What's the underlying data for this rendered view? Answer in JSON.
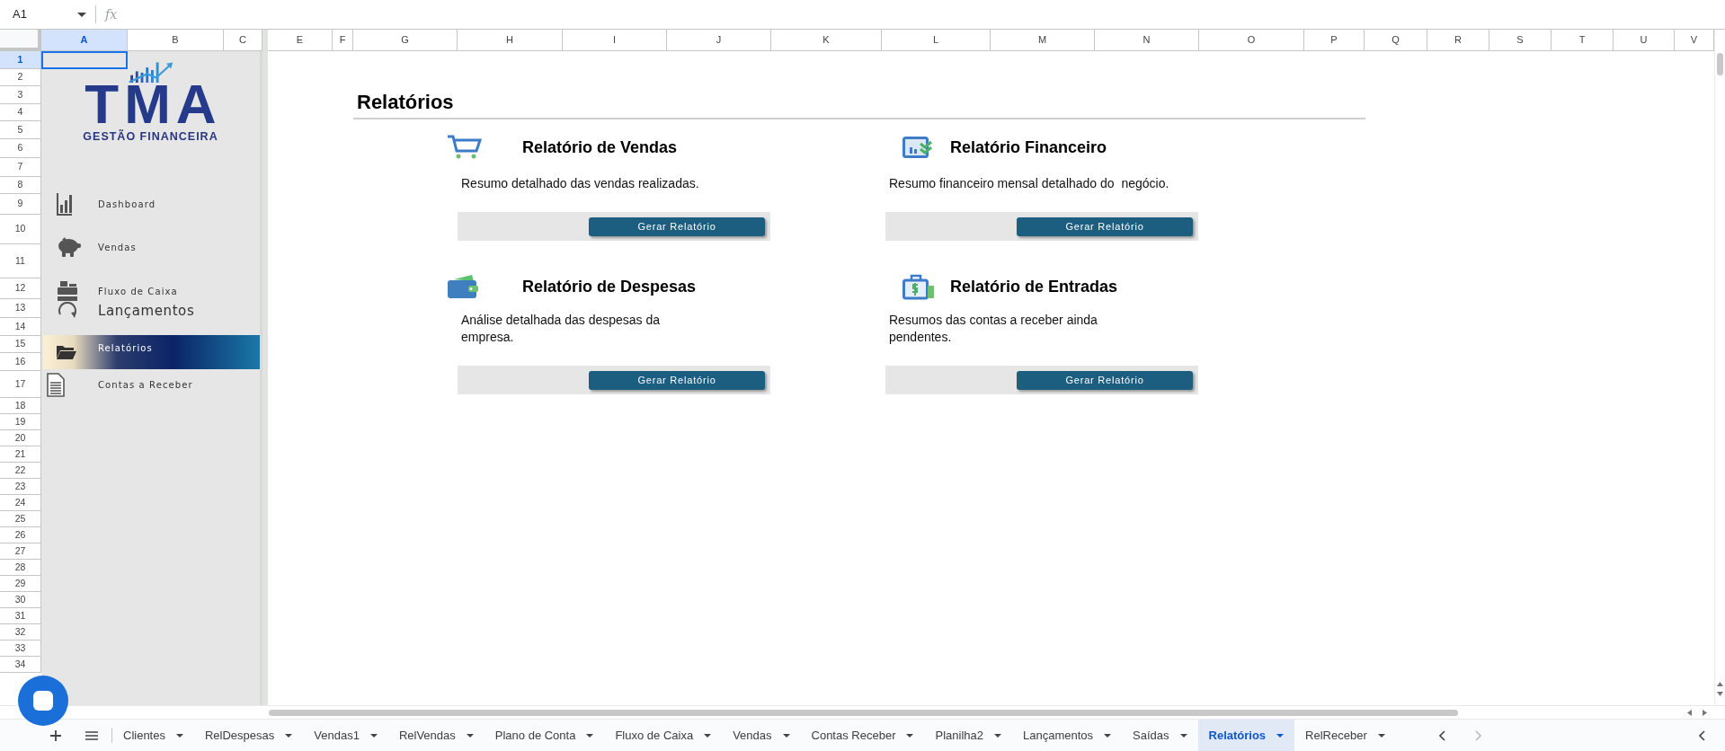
{
  "name_box": {
    "value": "A1"
  },
  "formula_bar": {
    "label": "fx"
  },
  "columns": [
    {
      "label": "A",
      "selected": true
    },
    {
      "label": "B",
      "selected": false
    },
    {
      "label": "C",
      "selected": false
    },
    {
      "label": "E",
      "selected": false
    },
    {
      "label": "F",
      "selected": false
    },
    {
      "label": "G",
      "selected": false
    },
    {
      "label": "H",
      "selected": false
    },
    {
      "label": "I",
      "selected": false
    },
    {
      "label": "J",
      "selected": false
    },
    {
      "label": "K",
      "selected": false
    },
    {
      "label": "L",
      "selected": false
    },
    {
      "label": "M",
      "selected": false
    },
    {
      "label": "N",
      "selected": false
    },
    {
      "label": "O",
      "selected": false
    },
    {
      "label": "P",
      "selected": false
    },
    {
      "label": "Q",
      "selected": false
    },
    {
      "label": "R",
      "selected": false
    },
    {
      "label": "S",
      "selected": false
    },
    {
      "label": "T",
      "selected": false
    },
    {
      "label": "U",
      "selected": false
    },
    {
      "label": "V",
      "selected": false
    }
  ],
  "rows": [
    {
      "label": "1",
      "selected": true
    },
    {
      "label": "2",
      "selected": false
    },
    {
      "label": "3",
      "selected": false
    },
    {
      "label": "4",
      "selected": false
    },
    {
      "label": "5",
      "selected": false
    },
    {
      "label": "6",
      "selected": false
    },
    {
      "label": "7",
      "selected": false
    },
    {
      "label": "8",
      "selected": false
    },
    {
      "label": "9",
      "selected": false
    },
    {
      "label": "10",
      "selected": false
    },
    {
      "label": "11",
      "selected": false
    },
    {
      "label": "12",
      "selected": false
    },
    {
      "label": "13",
      "selected": false
    },
    {
      "label": "14",
      "selected": false
    },
    {
      "label": "15",
      "selected": false
    },
    {
      "label": "16",
      "selected": false
    },
    {
      "label": "17",
      "selected": false
    },
    {
      "label": "18",
      "selected": false
    },
    {
      "label": "19",
      "selected": false
    },
    {
      "label": "20",
      "selected": false
    },
    {
      "label": "21",
      "selected": false
    },
    {
      "label": "22",
      "selected": false
    },
    {
      "label": "23",
      "selected": false
    },
    {
      "label": "24",
      "selected": false
    },
    {
      "label": "25",
      "selected": false
    },
    {
      "label": "26",
      "selected": false
    },
    {
      "label": "27",
      "selected": false
    },
    {
      "label": "28",
      "selected": false
    },
    {
      "label": "29",
      "selected": false
    },
    {
      "label": "30",
      "selected": false
    },
    {
      "label": "31",
      "selected": false
    },
    {
      "label": "32",
      "selected": false
    },
    {
      "label": "33",
      "selected": false
    },
    {
      "label": "34",
      "selected": false
    }
  ],
  "sidebar": {
    "logo": {
      "title": "TMA",
      "subtitle": "GESTÃO FINANCEIRA"
    },
    "items": [
      {
        "label": "Dashboard",
        "selected": false
      },
      {
        "label": "Vendas",
        "selected": false
      },
      {
        "label": "Fluxo de Caixa",
        "selected": false
      },
      {
        "label": "Lançamentos",
        "selected": false
      },
      {
        "label": "Relatórios",
        "selected": true
      },
      {
        "label": "Contas a Receber",
        "selected": false
      }
    ]
  },
  "page": {
    "title": "Relatórios",
    "reports": [
      {
        "title": "Relatório de Vendas",
        "description": "Resumo detalhado das vendas realizadas.",
        "button": "Gerar Relatório"
      },
      {
        "title": "Relatório Financeiro",
        "description": "Resumo financeiro mensal detalhado do  negócio.",
        "button": "Gerar Relatório"
      },
      {
        "title": "Relatório de Despesas",
        "description": "Análise detalhada das despesas da empresa.",
        "button": "Gerar Relatório"
      },
      {
        "title": "Relatório de Entradas",
        "description": "Resumos das contas a receber ainda pendentes.",
        "button": "Gerar Relatório"
      }
    ]
  },
  "sheet_tabs": [
    {
      "label": "Clientes",
      "selected": false
    },
    {
      "label": "RelDespesas",
      "selected": false
    },
    {
      "label": "Vendas1",
      "selected": false
    },
    {
      "label": "RelVendas",
      "selected": false
    },
    {
      "label": "Plano de Conta",
      "selected": false
    },
    {
      "label": "Fluxo de Caixa",
      "selected": false
    },
    {
      "label": "Vendas",
      "selected": false
    },
    {
      "label": "Contas Receber",
      "selected": false
    },
    {
      "label": "Planilha2",
      "selected": false
    },
    {
      "label": "Lançamentos",
      "selected": false
    },
    {
      "label": "Saídas",
      "selected": false
    },
    {
      "label": "Relatórios",
      "selected": true
    },
    {
      "label": "RelReceber",
      "selected": false
    }
  ]
}
